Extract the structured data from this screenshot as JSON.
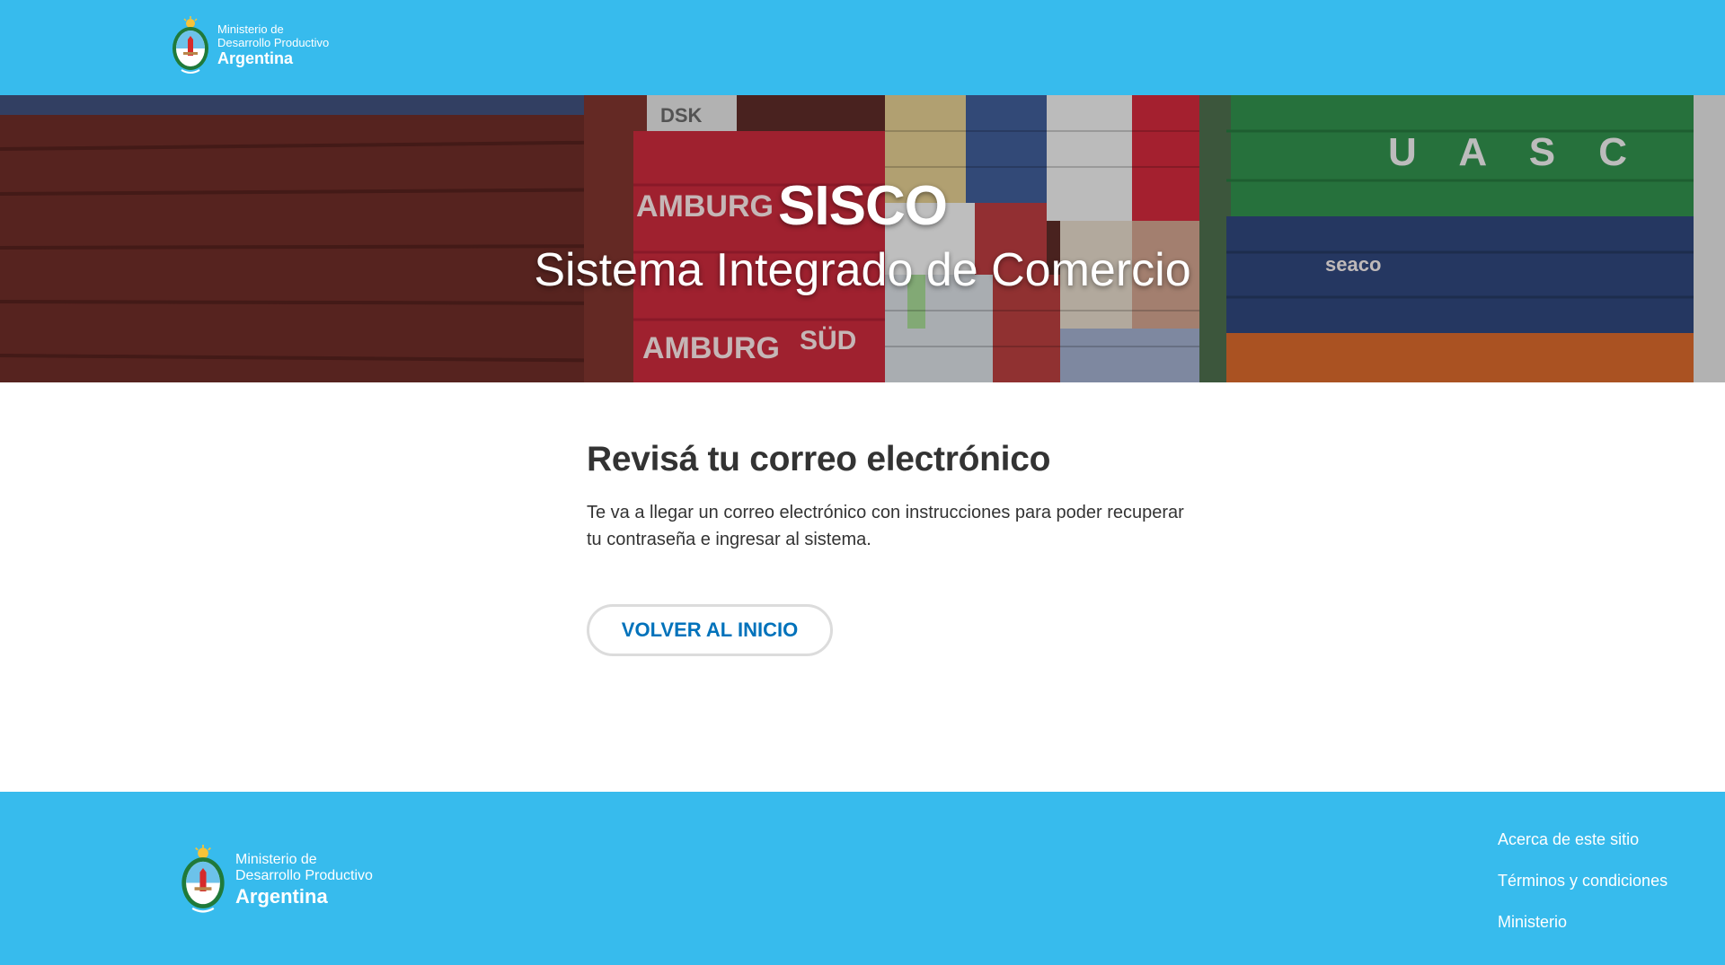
{
  "header": {
    "logo": {
      "icon": "coat-of-arms-icon",
      "line1": "Ministerio de",
      "line2": "Desarrollo Productivo",
      "country": "Argentina"
    }
  },
  "hero": {
    "title": "SISCO",
    "subtitle": "Sistema Integrado de Comercio",
    "image_text": {
      "hamburg_top": "AMBURG",
      "hamburg_bottom": "AMBURG",
      "sud": "SÜD",
      "uasc": "U A S C",
      "seaco": "seaco",
      "dsk": "DSK"
    }
  },
  "main": {
    "heading": "Revisá tu correo electrónico",
    "body": "Te va a llegar un correo electrónico con instrucciones para poder recuperar tu contraseña e ingresar al sistema.",
    "button_label": "VOLVER AL INICIO"
  },
  "footer": {
    "logo": {
      "icon": "coat-of-arms-icon",
      "line1": "Ministerio de",
      "line2": "Desarrollo Productivo",
      "country": "Argentina"
    },
    "links": [
      "Acerca de este sitio",
      "Términos y condiciones",
      "Ministerio"
    ]
  },
  "colors": {
    "brand_blue": "#37bbed",
    "button_text": "#0072bb",
    "button_border": "#dcdcdc",
    "text": "#333333"
  }
}
